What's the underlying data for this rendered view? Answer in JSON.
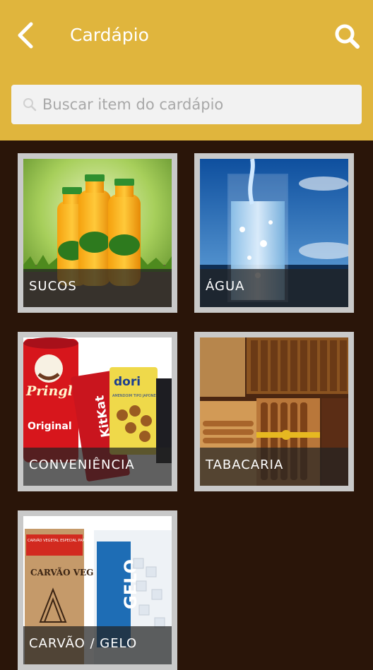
{
  "header": {
    "title": "Cardápio",
    "back_icon": "chevron-left-icon",
    "search_icon": "search-icon",
    "background_color": "#e0b53d"
  },
  "search": {
    "placeholder": "Buscar item do cardápio",
    "value": ""
  },
  "categories": [
    {
      "label": "SUCOS"
    },
    {
      "label": "ÁGUA"
    },
    {
      "label": "CONVENIÊNCIA"
    },
    {
      "label": "TABACARIA"
    },
    {
      "label": "CARVÃO / GELO"
    }
  ],
  "product_text": {
    "pringles_brand": "Pringles",
    "pringles_flavor": "Original",
    "kitkat_brand": "KitKat",
    "dori_brand": "dori",
    "dori_sub": "AMENDOIM TIPO JAPONES",
    "carvao_tag": "CARVÃO VEGETAL ESPECIAL PARA CHURRASCO",
    "carvao_brand": "CARVÃO VEGETAL",
    "gelo_brand": "GELO"
  },
  "colors": {
    "background": "#2a1509",
    "tile_border": "#c9c9c9",
    "label_overlay": "#232323"
  }
}
